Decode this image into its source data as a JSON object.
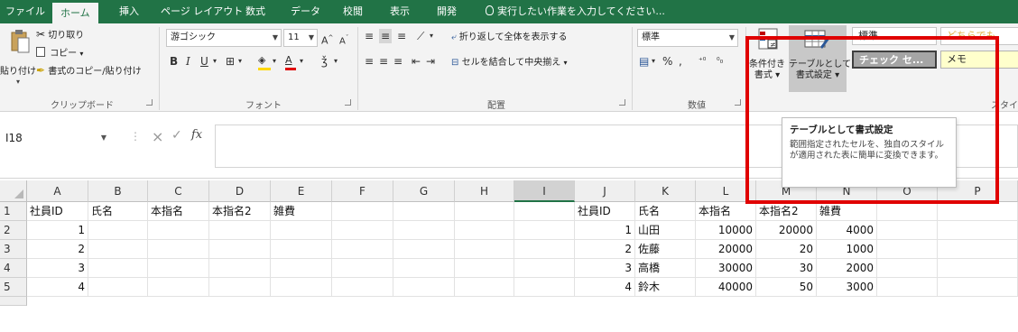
{
  "tabs": [
    "ファイル",
    "ホーム",
    "挿入",
    "ページ レイアウト",
    "数式",
    "データ",
    "校閲",
    "表示",
    "開発"
  ],
  "tell_me": "実行したい作業を入力してください...",
  "clipboard": {
    "paste": "貼り付け",
    "cut": "切り取り",
    "copy": "コピー",
    "format_painter": "書式のコピー/貼り付け",
    "label": "クリップボード"
  },
  "font": {
    "name": "游ゴシック",
    "size": "11",
    "label": "フォント"
  },
  "alignment": {
    "wrap": "折り返して全体を表示する",
    "merge": "セルを結合して中央揃え",
    "label": "配置"
  },
  "number": {
    "format": "標準",
    "label": "数値"
  },
  "styles": {
    "conditional": "条件付き書式",
    "conditional_l1": "条件付き",
    "conditional_l2": "書式",
    "table": "テーブルとして書式設定",
    "table_l1": "テーブルとして",
    "table_l2": "書式設定",
    "cell_normal": "標準",
    "cell_neutral": "どちらでも",
    "cell_check": "チェック セ...",
    "cell_memo": "メモ",
    "label": "スタイル"
  },
  "tooltip": {
    "title": "テーブルとして書式設定",
    "body": "範囲指定されたセルを、独自のスタイルが適用された表に簡単に変換できます。"
  },
  "name_box": "I18",
  "formula_icons": {
    "cancel": "×",
    "enter": "✓",
    "fx": "fx"
  },
  "columns": [
    "A",
    "B",
    "C",
    "D",
    "E",
    "F",
    "G",
    "H",
    "I",
    "J",
    "K",
    "L",
    "M",
    "N",
    "O",
    "P"
  ],
  "selected_column": "I",
  "rows": [
    {
      "num": "1",
      "cells": {
        "A": "社員ID",
        "B": "氏名",
        "C": "本指名",
        "D": "本指名2",
        "E": "雑費",
        "J": "社員ID",
        "K": "氏名",
        "L": "本指名",
        "M": "本指名2",
        "N": "雑費"
      }
    },
    {
      "num": "2",
      "cells": {
        "A": "1",
        "J": "1",
        "K": "山田",
        "L": "10000",
        "M": "20000",
        "N": "4000"
      }
    },
    {
      "num": "3",
      "cells": {
        "A": "2",
        "J": "2",
        "K": "佐藤",
        "L": "20000",
        "M": "20",
        "N": "1000"
      }
    },
    {
      "num": "4",
      "cells": {
        "A": "3",
        "J": "3",
        "K": "高橋",
        "L": "30000",
        "M": "30",
        "N": "2000"
      }
    },
    {
      "num": "5",
      "cells": {
        "A": "4",
        "J": "4",
        "K": "鈴木",
        "L": "40000",
        "M": "50",
        "N": "3000"
      }
    }
  ],
  "numeric_cells": [
    "A2",
    "A3",
    "A4",
    "A5",
    "J2",
    "J3",
    "J4",
    "J5",
    "L2",
    "L3",
    "L4",
    "L5",
    "M2",
    "M3",
    "M4",
    "M5",
    "N2",
    "N3",
    "N4",
    "N5"
  ],
  "colors": {
    "excel_green": "#217346",
    "highlight_red": "#e00000",
    "neutral_style_text": "#9c6500",
    "check_cell_fill": "#a5a5a5"
  }
}
